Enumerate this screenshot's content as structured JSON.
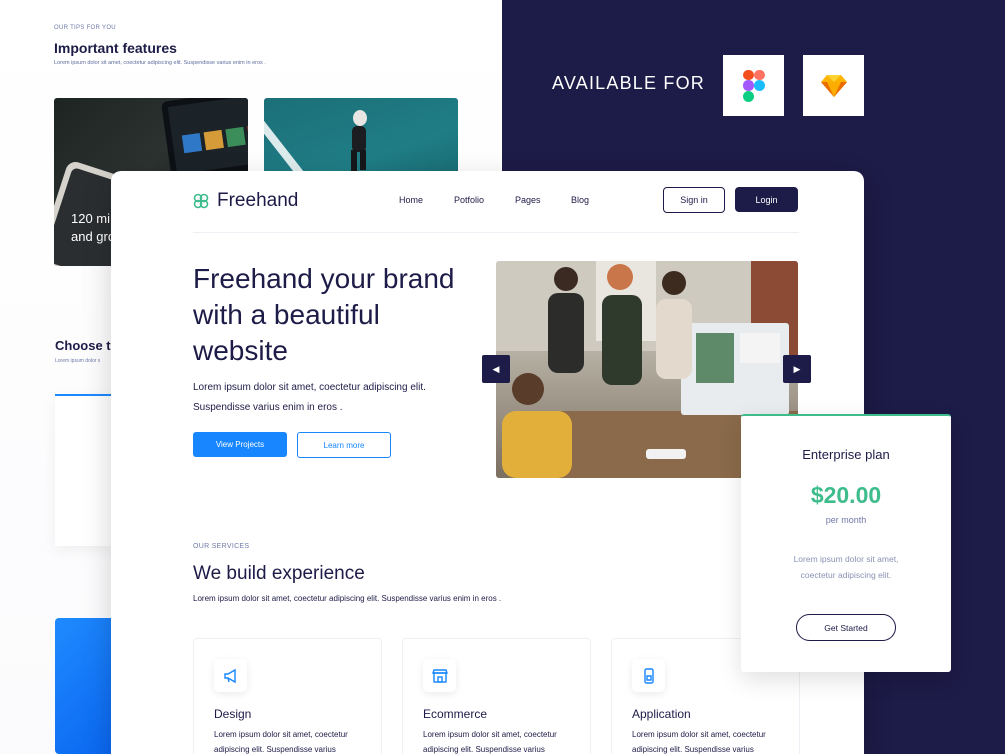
{
  "left_preview": {
    "eyebrow": "OUR TIPS FOR YOU",
    "title": "Important features",
    "subtitle": "Lorem ipsum dolor sit amet, coectetur adipiscing elit. Suspendisse varius enim in eros .",
    "photo_caption": "120 mi\nand gro",
    "choose_title": "Choose t",
    "choose_sub": "Lorem ipsum dolor s"
  },
  "available": {
    "label": "AVAILABLE FOR",
    "tools": [
      "figma-icon",
      "sketch-icon"
    ]
  },
  "site": {
    "brand": "Freehand",
    "nav": [
      "Home",
      "Potfolio",
      "Pages",
      "Blog"
    ],
    "signin_label": "Sign in",
    "login_label": "Login",
    "hero": {
      "title": "Freehand your brand with a beautiful website",
      "description": "Lorem ipsum dolor sit amet, coectetur adipiscing elit. Suspendisse varius enim in eros .",
      "primary_cta": "View Projects",
      "secondary_cta": "Learn more"
    },
    "services": {
      "eyebrow": "OUR SERVICES",
      "title": "We build experience",
      "subtitle": "Lorem ipsum dolor sit amet, coectetur adipiscing elit. Suspendisse varius enim in eros .",
      "items": [
        {
          "title": "Design",
          "icon": "megaphone-icon",
          "desc": "Lorem ipsum dolor sit amet, coectetur adipiscing elit. Suspendisse varius"
        },
        {
          "title": "Ecommerce",
          "icon": "storefront-icon",
          "desc": "Lorem ipsum dolor sit amet, coectetur adipiscing elit. Suspendisse varius"
        },
        {
          "title": "Application",
          "icon": "mobile-app-icon",
          "desc": "Lorem ipsum dolor sit amet, coectetur adipiscing elit. Suspendisse varius"
        }
      ]
    }
  },
  "plan": {
    "title": "Enterprise plan",
    "price": "$20.00",
    "period": "per month",
    "description": "Lorem ipsum dolor sit amet, coectetur adipiscing elit.",
    "cta": "Get Started"
  },
  "colors": {
    "navy": "#1d1b47",
    "accent_blue": "#1786ff",
    "accent_green": "#3ebc8c"
  }
}
